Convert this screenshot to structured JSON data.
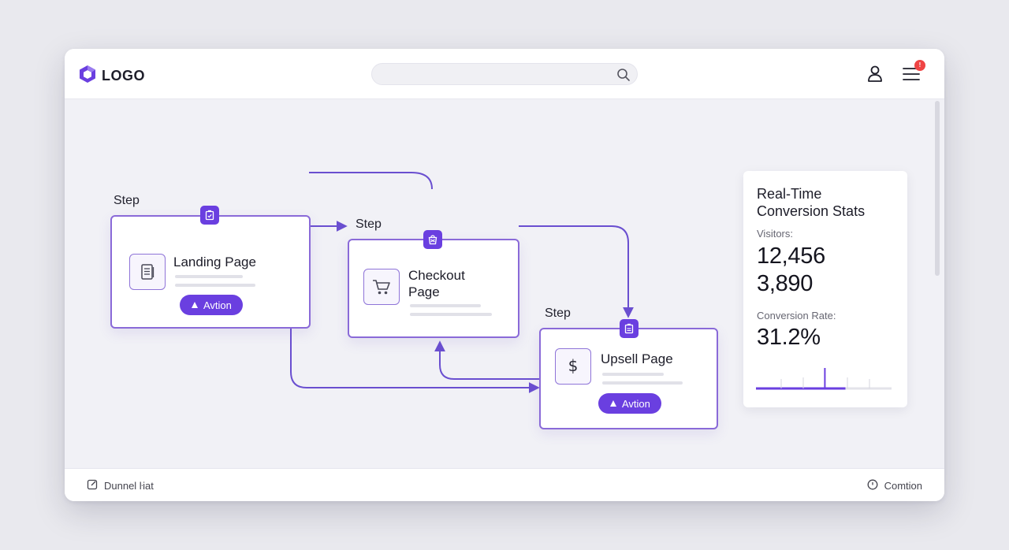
{
  "header": {
    "logo_text": "LOGO",
    "search_placeholder": "",
    "notification_count": "!"
  },
  "funnel": {
    "steps": [
      {
        "step_label": "Step",
        "title": "Landing Page",
        "action_label": "Avtion",
        "icon": "document-icon"
      },
      {
        "step_label": "Step",
        "title_line1": "Checkout",
        "title_line2": "Page",
        "icon": "cart-icon"
      },
      {
        "step_label": "Step",
        "title": "Upsell Page",
        "action_label": "Avtion",
        "icon": "dollar-icon"
      }
    ]
  },
  "stats": {
    "title_line1": "Real-Time",
    "title_line2": "Conversion Stats",
    "visitors_label": "Visitors:",
    "visitors_value": "12,456",
    "conversions_value": "3,890",
    "rate_label": "Conversion Rate:",
    "rate_value": "31.2%",
    "progress_fraction": 0.66
  },
  "footer": {
    "left_label": "Dunnel ŀiat",
    "right_label": "Comtion"
  },
  "colors": {
    "accent": "#6a3fe0",
    "node_border": "#8a6ad8",
    "connector": "#6a4fd0",
    "badge": "#ef4444"
  }
}
